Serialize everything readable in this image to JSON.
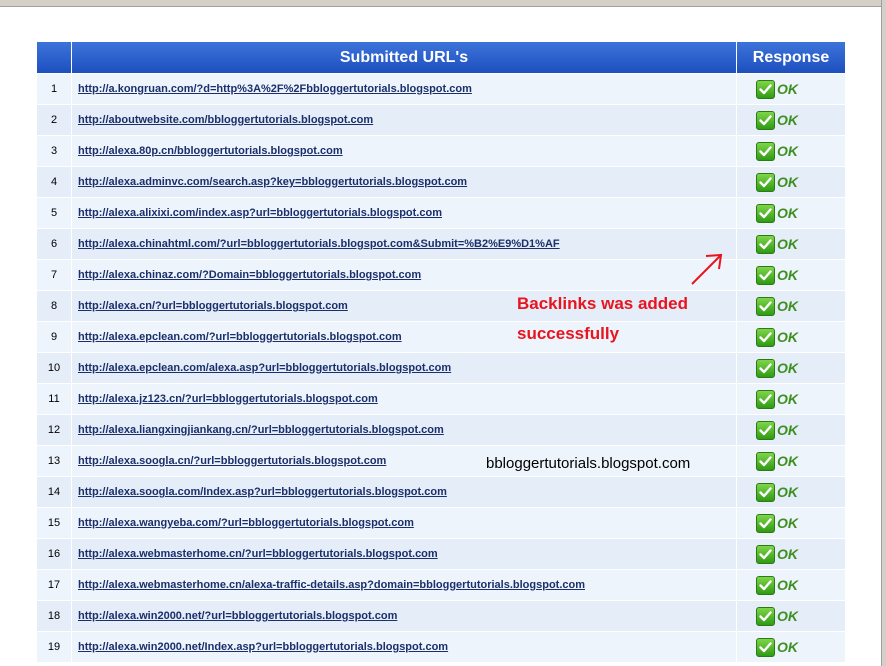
{
  "table": {
    "header_url": "Submitted URL's",
    "header_response": "Response",
    "rows": [
      {
        "num": "1",
        "url": "http://a.kongruan.com/?d=http%3A%2F%2Fbbloggertutorials.blogspot.com",
        "status": "OK"
      },
      {
        "num": "2",
        "url": "http://aboutwebsite.com/bbloggertutorials.blogspot.com",
        "status": "OK"
      },
      {
        "num": "3",
        "url": "http://alexa.80p.cn/bbloggertutorials.blogspot.com",
        "status": "OK"
      },
      {
        "num": "4",
        "url": "http://alexa.adminvc.com/search.asp?key=bbloggertutorials.blogspot.com",
        "status": "OK"
      },
      {
        "num": "5",
        "url": "http://alexa.alixixi.com/index.asp?url=bbloggertutorials.blogspot.com",
        "status": "OK"
      },
      {
        "num": "6",
        "url": "http://alexa.chinahtml.com/?url=bbloggertutorials.blogspot.com&Submit=%B2%E9%D1%AF",
        "status": "OK"
      },
      {
        "num": "7",
        "url": "http://alexa.chinaz.com/?Domain=bbloggertutorials.blogspot.com",
        "status": "OK"
      },
      {
        "num": "8",
        "url": "http://alexa.cn/?url=bbloggertutorials.blogspot.com",
        "status": "OK"
      },
      {
        "num": "9",
        "url": "http://alexa.epclean.com/?url=bbloggertutorials.blogspot.com",
        "status": "OK"
      },
      {
        "num": "10",
        "url": "http://alexa.epclean.com/alexa.asp?url=bbloggertutorials.blogspot.com",
        "status": "OK"
      },
      {
        "num": "11",
        "url": "http://alexa.jz123.cn/?url=bbloggertutorials.blogspot.com",
        "status": "OK"
      },
      {
        "num": "12",
        "url": "http://alexa.liangxingjiankang.cn/?url=bbloggertutorials.blogspot.com",
        "status": "OK"
      },
      {
        "num": "13",
        "url": "http://alexa.soogla.cn/?url=bbloggertutorials.blogspot.com",
        "status": "OK"
      },
      {
        "num": "14",
        "url": "http://alexa.soogla.com/Index.asp?url=bbloggertutorials.blogspot.com",
        "status": "OK"
      },
      {
        "num": "15",
        "url": "http://alexa.wangyeba.com/?url=bbloggertutorials.blogspot.com",
        "status": "OK"
      },
      {
        "num": "16",
        "url": "http://alexa.webmasterhome.cn/?url=bbloggertutorials.blogspot.com",
        "status": "OK"
      },
      {
        "num": "17",
        "url": "http://alexa.webmasterhome.cn/alexa-traffic-details.asp?domain=bbloggertutorials.blogspot.com",
        "status": "OK"
      },
      {
        "num": "18",
        "url": "http://alexa.win2000.net/?url=bbloggertutorials.blogspot.com",
        "status": "OK"
      },
      {
        "num": "19",
        "url": "http://alexa.win2000.net/Index.asp?url=bbloggertutorials.blogspot.com",
        "status": "OK"
      }
    ]
  },
  "annotation": {
    "line1": "Backlinks was added",
    "line2": "successfully"
  },
  "watermark": "bbloggertutorials.blogspot.com",
  "colors": {
    "header_blue": "#2a5fce",
    "ok_green": "#3d8f1f",
    "annotation_red": "#e8141e"
  }
}
